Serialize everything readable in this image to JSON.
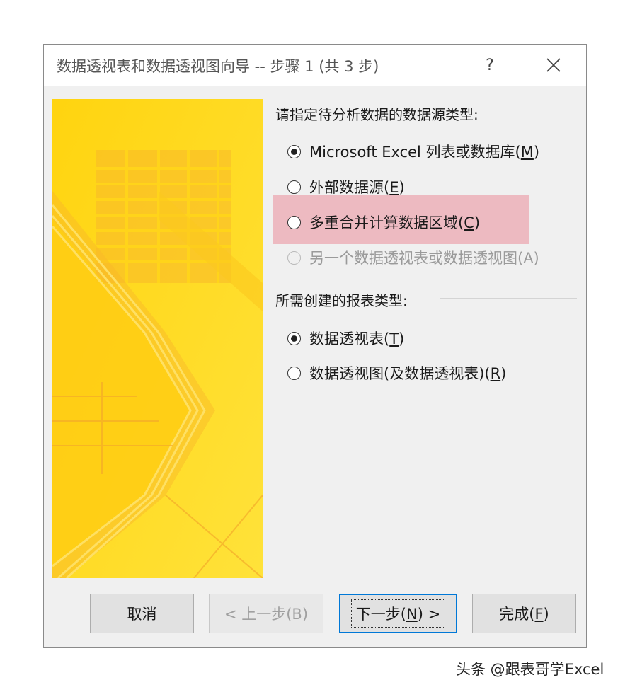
{
  "window": {
    "title": "数据透视表和数据透视图向导 -- 步骤 1 (共 3 步)",
    "help_label": "?"
  },
  "source_section": {
    "label": "请指定待分析数据的数据源类型:",
    "options": [
      {
        "text": "Microsoft Excel 列表或数据库(",
        "key": "M",
        "after": ")",
        "selected": true,
        "enabled": true
      },
      {
        "text": "外部数据源(",
        "key": "E",
        "after": ")",
        "selected": false,
        "enabled": true
      },
      {
        "text": "多重合并计算数据区域(",
        "key": "C",
        "after": ")",
        "selected": false,
        "enabled": true,
        "highlighted": true
      },
      {
        "text": "另一个数据透视表或数据透视图(A)",
        "key": "",
        "after": "",
        "selected": false,
        "enabled": false
      }
    ]
  },
  "report_section": {
    "label": "所需创建的报表类型:",
    "options": [
      {
        "text": "数据透视表(",
        "key": "T",
        "after": ")",
        "selected": true,
        "enabled": true
      },
      {
        "text": "数据透视图(及数据透视表)(",
        "key": "R",
        "after": ")",
        "selected": false,
        "enabled": true
      }
    ]
  },
  "buttons": {
    "cancel": "取消",
    "back": "< 上一步(B)",
    "next_pre": "下一步(",
    "next_key": "N",
    "next_post": ") >",
    "finish_pre": "完成(",
    "finish_key": "F",
    "finish_post": ")"
  },
  "watermark": "头条 @跟表哥学Excel",
  "colors": {
    "highlight": "#e97887",
    "banner": "#ffd21c",
    "focus": "#0078d7"
  }
}
